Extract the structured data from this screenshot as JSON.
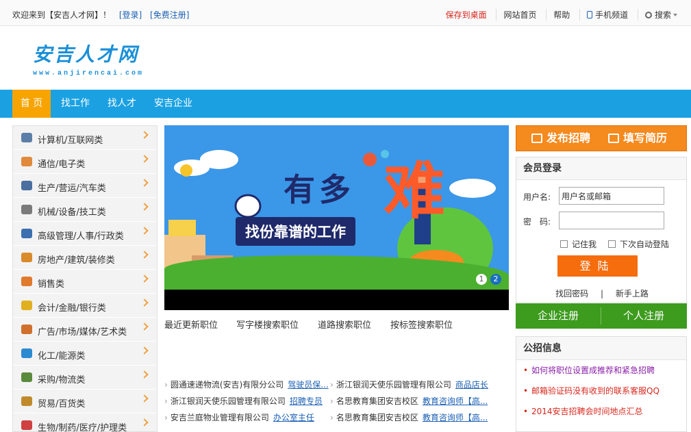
{
  "topbar": {
    "welcome": "欢迎来到【安吉人才网】！",
    "login": "[登录]",
    "register": "[免费注册]",
    "save_desktop": "保存到桌面",
    "home": "网站首页",
    "help": "帮助",
    "mobile": "手机频道",
    "search": "搜索"
  },
  "logo": {
    "name": "安吉人才网",
    "domain": "www.anjirencai.com"
  },
  "nav": {
    "items": [
      {
        "label": "首 页"
      },
      {
        "label": "找工作"
      },
      {
        "label": "找人才"
      },
      {
        "label": "安吉企业"
      }
    ]
  },
  "categories": [
    {
      "label": "计算机/互联网类",
      "icon": "computer-icon",
      "color": "#5b7fa8"
    },
    {
      "label": "通信/电子类",
      "icon": "signal-icon",
      "color": "#e08a3c"
    },
    {
      "label": "生产/营运/汽车类",
      "icon": "truck-icon",
      "color": "#4a6fa0"
    },
    {
      "label": "机械/设备/技工类",
      "icon": "tools-icon",
      "color": "#7a7a7a"
    },
    {
      "label": "高级管理/人事/行政类",
      "icon": "person-icon",
      "color": "#3c6fb0"
    },
    {
      "label": "房地产/建筑/装修类",
      "icon": "house-icon",
      "color": "#d98a2c"
    },
    {
      "label": "销售类",
      "icon": "chat-icon",
      "color": "#e07a2c"
    },
    {
      "label": "会计/金融/银行类",
      "icon": "coins-icon",
      "color": "#e0b020"
    },
    {
      "label": "广告/市场/媒体/艺术类",
      "icon": "board-icon",
      "color": "#d0702c"
    },
    {
      "label": "化工/能源类",
      "icon": "globe-icon",
      "color": "#2c8ad0"
    },
    {
      "label": "采购/物流类",
      "icon": "delivery-icon",
      "color": "#5a8a3c"
    },
    {
      "label": "贸易/百货类",
      "icon": "hammer-icon",
      "color": "#c08a2c"
    },
    {
      "label": "生物/制药/医疗/护理类",
      "icon": "medical-icon",
      "color": "#d04040"
    }
  ],
  "banner": {
    "headline": "有多",
    "big_char": "难",
    "tagline": "找份靠谱的工作",
    "dots": [
      "1",
      "2"
    ]
  },
  "quick_links": [
    "最近更新职位",
    "写字楼搜索职位",
    "道路搜索职位",
    "按标签搜索职位"
  ],
  "jobs": [
    {
      "left_company": "圆通速递物流(安吉)有限分公司",
      "left_position": "驾驶员保...",
      "right_company": "浙江银润天使乐园管理有限公司",
      "right_position": "商品店长"
    },
    {
      "left_company": "浙江银润天使乐园管理有限公司",
      "left_position": "招聘专员",
      "right_company": "名思教育集团安吉校区",
      "right_position": "教育咨询师【高..."
    },
    {
      "left_company": "安吉兰庭物业管理有限公司",
      "left_position": "办公室主任",
      "right_company": "名思教育集团安吉校区",
      "right_position": "教育咨询师【高..."
    }
  ],
  "actions": {
    "post_job": "发布招聘",
    "fill_resume": "填写简历"
  },
  "login": {
    "title": "会员登录",
    "username_label": "用户名:",
    "username_placeholder": "用户名或邮箱",
    "password_label": "密　码:",
    "remember": "记住我",
    "auto_login": "下次自动登陆",
    "submit": "登陆",
    "forgot": "找回密码",
    "sep": "|",
    "newbie": "新手上路"
  },
  "register": {
    "company": "企业注册",
    "personal": "个人注册"
  },
  "notice": {
    "title": "公招信息",
    "items": [
      {
        "text": "如何将职位设置成推荐和紧急招聘",
        "color": "#8a1ea8"
      },
      {
        "text": "邮箱验证码没有收到的联系客服QQ",
        "color": "#d9261c"
      },
      {
        "text": "2014安吉招聘会时间地点汇总",
        "color": "#d9261c"
      }
    ]
  }
}
